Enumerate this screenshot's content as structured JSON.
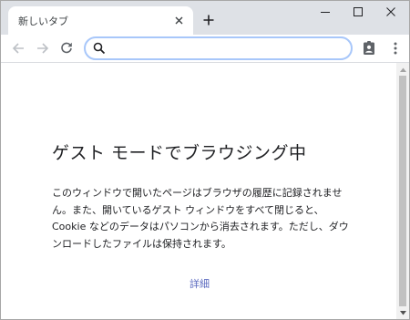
{
  "window": {
    "tab_title": "新しいタブ",
    "controls": {
      "minimize": "minimize",
      "maximize": "maximize",
      "close": "close"
    }
  },
  "toolbar": {
    "omnibox_value": "",
    "omnibox_placeholder": ""
  },
  "content": {
    "heading": "ゲスト モードでブラウジング中",
    "description": "このウィンドウで開いたページはブラウザの履歴に記録されません。また、開いているゲスト ウィンドウをすべて閉じると、Cookie などのデータはパソコンから消去されます。ただし、ダウンロードしたファイルは保持されます。",
    "details_link": "詳細"
  },
  "colors": {
    "tabstrip_bg": "#dee1e6",
    "omnibox_focus": "#a8c7fa",
    "link": "#5c6bc0",
    "icon": "#5f6368"
  },
  "icons": [
    "close-icon",
    "plus-icon",
    "minimize-icon",
    "maximize-icon",
    "back-arrow-icon",
    "forward-arrow-icon",
    "reload-icon",
    "search-icon",
    "guest-profile-icon",
    "more-vert-icon",
    "scroll-up-icon",
    "scroll-down-icon"
  ]
}
